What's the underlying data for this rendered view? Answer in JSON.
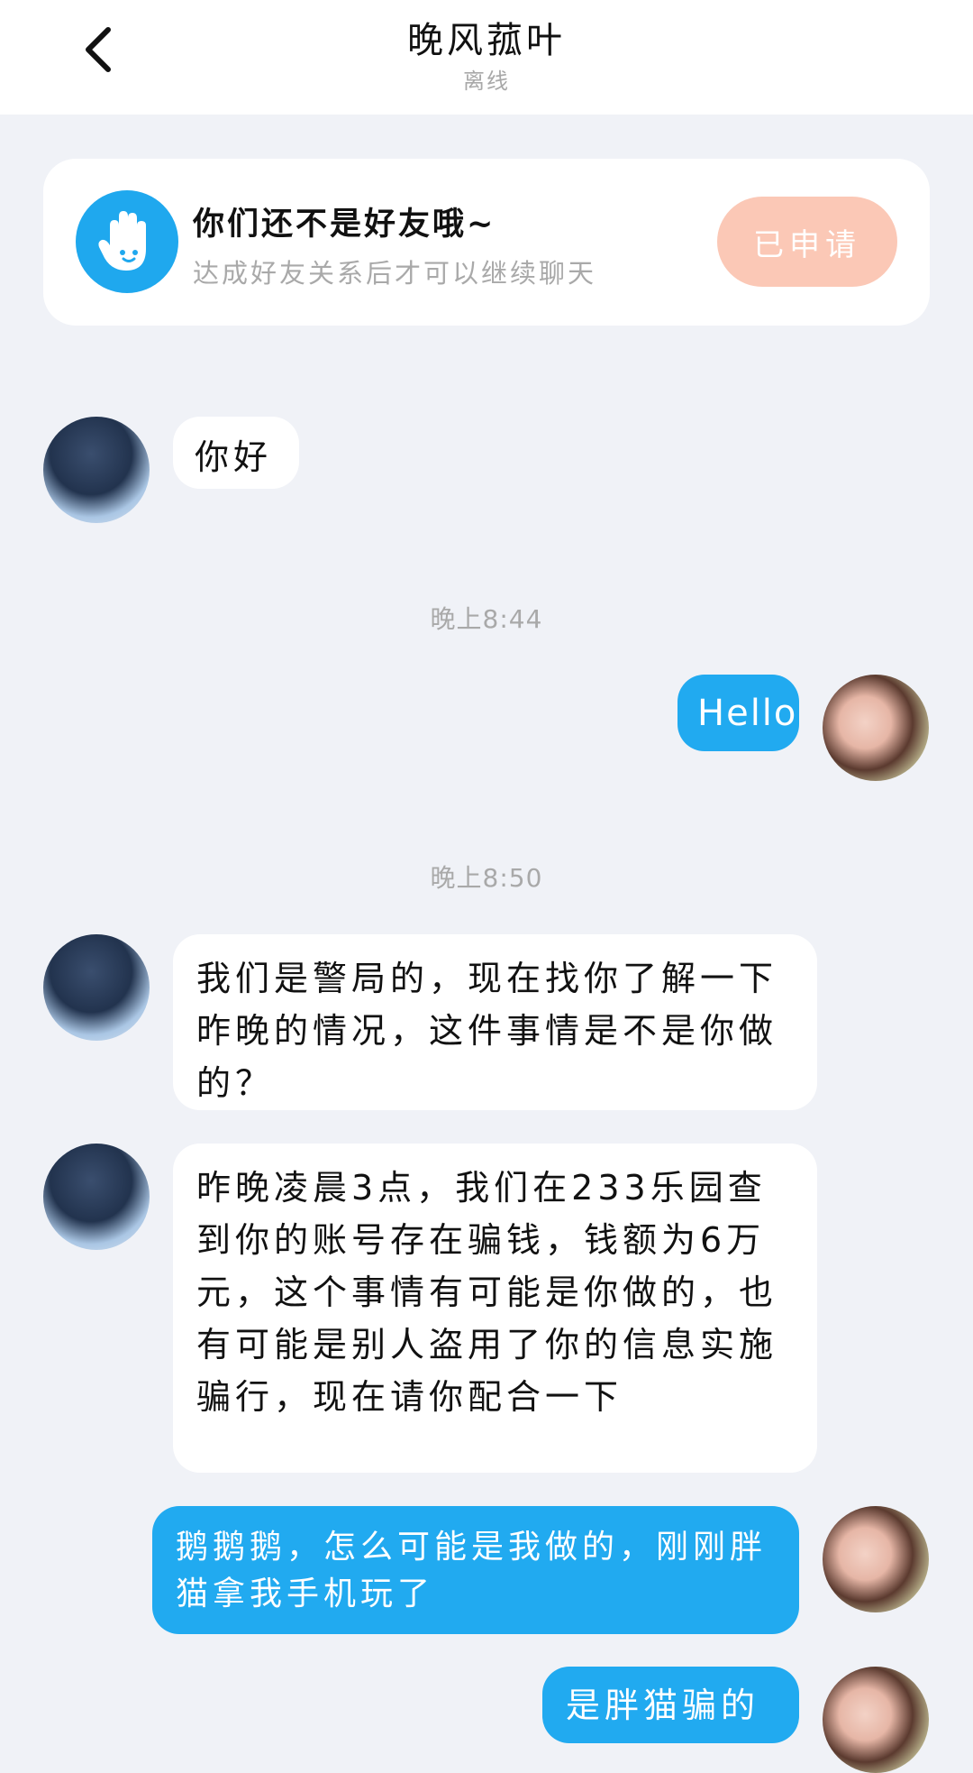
{
  "header": {
    "title": "晚风菰叶",
    "status": "离线"
  },
  "notice": {
    "title": "你们还不是好友哦~",
    "subtitle": "达成好友关系后才可以继续聊天",
    "button_label": "已申请"
  },
  "messages": [
    {
      "side": "in",
      "text": "你好"
    },
    {
      "time": "晚上8:44"
    },
    {
      "side": "out",
      "text": "Hello"
    },
    {
      "time": "晚上8:50"
    },
    {
      "side": "in",
      "text": "我们是警局的，现在找你了解一下昨晚的情况，这件事情是不是你做的？"
    },
    {
      "side": "in",
      "text": "昨晚凌晨3点，我们在233乐园查到你的账号存在骗钱，钱额为6万元，这个事情有可能是你做的，也有可能是别人盗用了你的信息实施骗行，现在请你配合一下"
    },
    {
      "side": "out",
      "text": "鹅鹅鹅，怎么可能是我做的，刚刚胖猫拿我手机玩了"
    },
    {
      "side": "out",
      "text": "是胖猫骗的"
    }
  ],
  "colors": {
    "background": "#f0f2f7",
    "outgoing_bubble": "#21aaf0",
    "incoming_bubble": "#ffffff",
    "apply_button": "#fbc8b6",
    "notice_icon": "#1fa8ee"
  },
  "icons": {
    "back": "chevron-left-icon",
    "notice": "hand-wave-icon"
  }
}
